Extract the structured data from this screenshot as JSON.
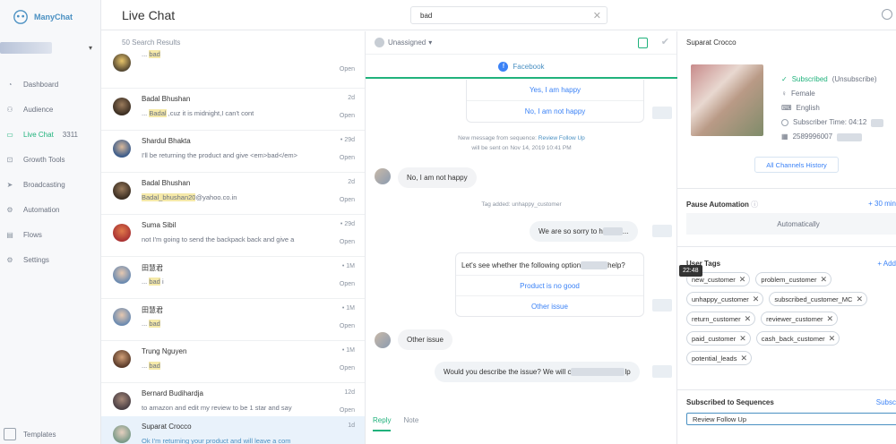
{
  "app": {
    "name": "ManyChat"
  },
  "sidebar": {
    "items": [
      {
        "label": "Dashboard",
        "icon": "dashboard-icon"
      },
      {
        "label": "Audience",
        "icon": "audience-icon"
      },
      {
        "label": "Live Chat",
        "icon": "chat-icon",
        "count": "3311",
        "active": true
      },
      {
        "label": "Growth Tools",
        "icon": "growth-tools-icon"
      },
      {
        "label": "Broadcasting",
        "icon": "broadcast-icon"
      },
      {
        "label": "Automation",
        "icon": "automation-icon"
      },
      {
        "label": "Flows",
        "icon": "flows-icon"
      },
      {
        "label": "Settings",
        "icon": "settings-icon"
      }
    ],
    "templates": "Templates"
  },
  "header": {
    "title": "Live Chat",
    "search_value": "bad"
  },
  "list": {
    "results": "50 Search Results",
    "rows": [
      {
        "name": "",
        "pre": "... ",
        "hl": "bad",
        "post": "",
        "time": "",
        "status": "Open"
      },
      {
        "name": "Badal Bhushan",
        "pre": "... ",
        "hl": "Badal",
        "post": " ,cuz it is midnight,I can't cont",
        "time": "2d",
        "status": "Open"
      },
      {
        "name": "Shardul Bhakta",
        "pre": "I'll be returning the product and give <em>bad</em>",
        "hl": "",
        "post": "",
        "time": "• 29d",
        "status": "Open"
      },
      {
        "name": "Badal Bhushan",
        "pre": "",
        "hl": "Badal_bhushan20",
        "post": "@yahoo.co.in",
        "time": "2d",
        "status": "Open"
      },
      {
        "name": "Suma Sibil",
        "pre": "not I'm going to send the backpack back and give a",
        "hl": "",
        "post": "",
        "time": "• 29d",
        "status": "Open"
      },
      {
        "name": "田慧君",
        "pre": "... ",
        "hl": "bad",
        "post": " i",
        "time": "• 1M",
        "status": "Open"
      },
      {
        "name": "田慧君",
        "pre": "... ",
        "hl": "bad",
        "post": "",
        "time": "• 1M",
        "status": "Open"
      },
      {
        "name": "Trung Nguyen",
        "pre": "... ",
        "hl": "bad",
        "post": "",
        "time": "• 1M",
        "status": "Open"
      },
      {
        "name": "Bernard Budihardja",
        "pre": "to amazon and edit my review to be 1 star and say",
        "hl": "",
        "post": "",
        "time": "12d",
        "status": "Open"
      },
      {
        "name": "Suparat Crocco",
        "pre": "Ok I'm returning your product and will leave a com",
        "hl": "",
        "post": "",
        "time": "1d",
        "status": ""
      }
    ]
  },
  "chat": {
    "assignee": "Unassigned",
    "channel": "Facebook",
    "card1": {
      "btn1": "Yes, I am happy",
      "btn2": "No, I am not happy"
    },
    "sys1": "New message from sequence:",
    "sys1_link": "Review Follow Up",
    "sys1_line2": "will be sent on Nov 14, 2019 10:41 PM",
    "msg_in1": "No, I am not happy",
    "sys2": "Tag added: unhappy_customer",
    "msg_out1": "We are so sorry to h",
    "msg_out1_end": "...",
    "card2": {
      "question": "Let's see whether the following option",
      "question_end": "help?",
      "btn1": "Product is no good",
      "btn2": "Other issue"
    },
    "msg_in2": "Other issue",
    "msg_out2": "Would you describe the issue? We will c",
    "msg_out2_end": "lp",
    "tooltip": "22:48",
    "tab_reply": "Reply",
    "tab_note": "Note"
  },
  "profile": {
    "name": "Suparat Crocco",
    "subscribed": "Subscribed",
    "unsubscribe": "(Unsubscribe)",
    "gender": "Female",
    "language": "English",
    "sub_time_label": "Subscriber Time: 04:12",
    "phone": "2589996007",
    "history_button": "All Channels History",
    "pause_title": "Pause Automation",
    "pause_action": "+ 30 min",
    "pause_value": "Automatically",
    "tags_title": "User Tags",
    "tags_add": "+ Add",
    "tags": [
      "new_customer",
      "problem_customer",
      "unhappy_customer",
      "subscribed_customer_MC",
      "return_customer",
      "reviewer_customer",
      "paid_customer",
      "cash_back_customer",
      "potential_leads"
    ],
    "seq_title": "Subscribed to Sequences",
    "seq_action": "Subsc",
    "seq_value": "Review Follow Up"
  },
  "colors": {
    "accent": "#20b27c",
    "link": "#3b82f6",
    "highlight": "#f5e9a9",
    "selected_row": "#e9f2fb"
  }
}
